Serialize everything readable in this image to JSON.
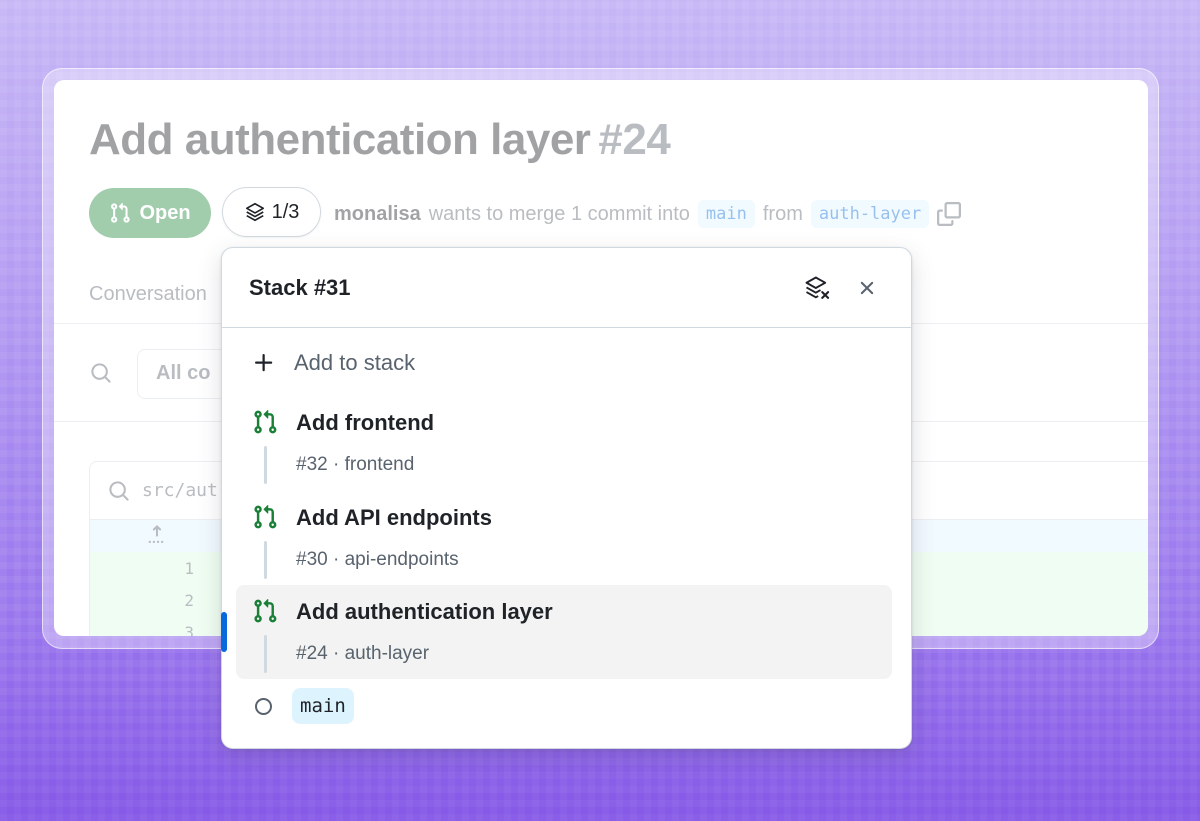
{
  "pull_request": {
    "title": "Add authentication layer",
    "number": "#24",
    "state_label": "Open",
    "author": "monalisa",
    "merge_text": "wants to merge 1 commit into",
    "base_branch": "main",
    "from_text": "from",
    "head_branch": "auth-layer"
  },
  "stack_toggle": {
    "label": "1/3",
    "icon": "stack-icon"
  },
  "tabs": {
    "conversation": "Conversation"
  },
  "filter": {
    "value": "All co"
  },
  "file": {
    "path": "src/aut",
    "lines": [
      "1",
      "2",
      "3"
    ]
  },
  "stack_popover": {
    "title": "Stack #31",
    "add_label": "Add to stack",
    "items": [
      {
        "title": "Add frontend",
        "sub": "#32 · frontend"
      },
      {
        "title": "Add API endpoints",
        "sub": "#30 · api-endpoints"
      },
      {
        "title": "Add authentication layer",
        "sub": "#24 · auth-layer"
      }
    ],
    "base_branch": "main"
  },
  "colors": {
    "open_green": "#1f883d",
    "pr_icon_green": "#1a7f37",
    "accent_blue": "#0969da",
    "background_purple": "#9c7aee"
  }
}
